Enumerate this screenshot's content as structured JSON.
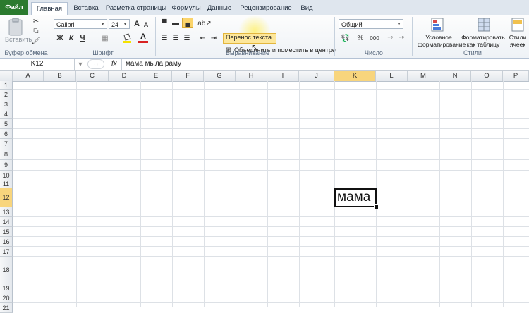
{
  "tabs": [
    "Файл",
    "Главная",
    "Вставка",
    "Разметка страницы",
    "Формулы",
    "Данные",
    "Рецензирование",
    "Вид"
  ],
  "clipboard": {
    "paste_label": "Вставить",
    "group_label": "Буфер обмена"
  },
  "font": {
    "name": "Calibri",
    "size": "24",
    "group_label": "Шрифт",
    "bold": "Ж",
    "italic": "К",
    "underline": "Ч",
    "grow": "A",
    "shrink": "A",
    "font_color": "A"
  },
  "alignment": {
    "wrap_text": "Перенос текста",
    "merge_center": "Объединить и поместить в центре",
    "group_label": "Выравнивание"
  },
  "number": {
    "format": "Общий",
    "group_label": "Число",
    "percent": "%",
    "thousands": "000"
  },
  "styles": {
    "conditional": "Условное форматирование",
    "format_table": "Форматировать как таблицу",
    "cell_styles": "Стили ячеек",
    "group_label": "Стили"
  },
  "formula_bar": {
    "cell_ref": "K12",
    "fx": "fx",
    "content": "мама мыла раму"
  },
  "columns": [
    "A",
    "B",
    "C",
    "D",
    "E",
    "F",
    "G",
    "H",
    "I",
    "J",
    "K",
    "L",
    "M",
    "N",
    "O",
    "P"
  ],
  "rows": [
    "1",
    "2",
    "3",
    "4",
    "5",
    "6",
    "7",
    "8",
    "9",
    "10",
    "11",
    "12",
    "13",
    "14",
    "15",
    "16",
    "17",
    "18",
    "19",
    "20",
    "21"
  ],
  "selected_cell": {
    "ref": "K12",
    "display_text": "мама"
  },
  "colors": {
    "file_tab": "#2b7a2e",
    "selection_header": "#f8d57d",
    "highlight": "#fde79b"
  }
}
